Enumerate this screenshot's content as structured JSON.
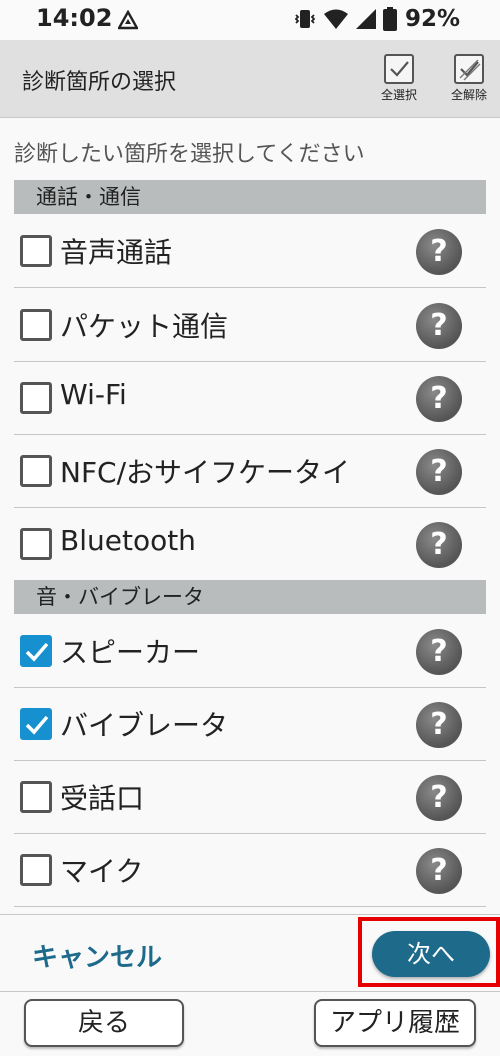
{
  "status_bar": {
    "time": "14:02",
    "battery": "92%"
  },
  "app_bar": {
    "title": "診断箇所の選択",
    "select_all": "全選択",
    "deselect_all": "全解除"
  },
  "instruction": "診断したい箇所を選択してください",
  "sections": [
    {
      "title": "通話・通信",
      "items": [
        {
          "label": "音声通話",
          "checked": false
        },
        {
          "label": "パケット通信",
          "checked": false
        },
        {
          "label": "Wi-Fi",
          "checked": false
        },
        {
          "label": "NFC/おサイフケータイ",
          "checked": false
        },
        {
          "label": "Bluetooth",
          "checked": false
        }
      ]
    },
    {
      "title": "音・バイブレータ",
      "items": [
        {
          "label": "スピーカー",
          "checked": true
        },
        {
          "label": "バイブレータ",
          "checked": true
        },
        {
          "label": "受話口",
          "checked": false
        },
        {
          "label": "マイク",
          "checked": false
        }
      ]
    }
  ],
  "help_glyph": "?",
  "footer": {
    "cancel": "キャンセル",
    "next": "次へ",
    "back": "戻る",
    "app_history": "アプリ履歴"
  },
  "colors": {
    "accent": "#1e6a8a",
    "checkbox_checked": "#1790d0",
    "highlight": "#e60000"
  }
}
